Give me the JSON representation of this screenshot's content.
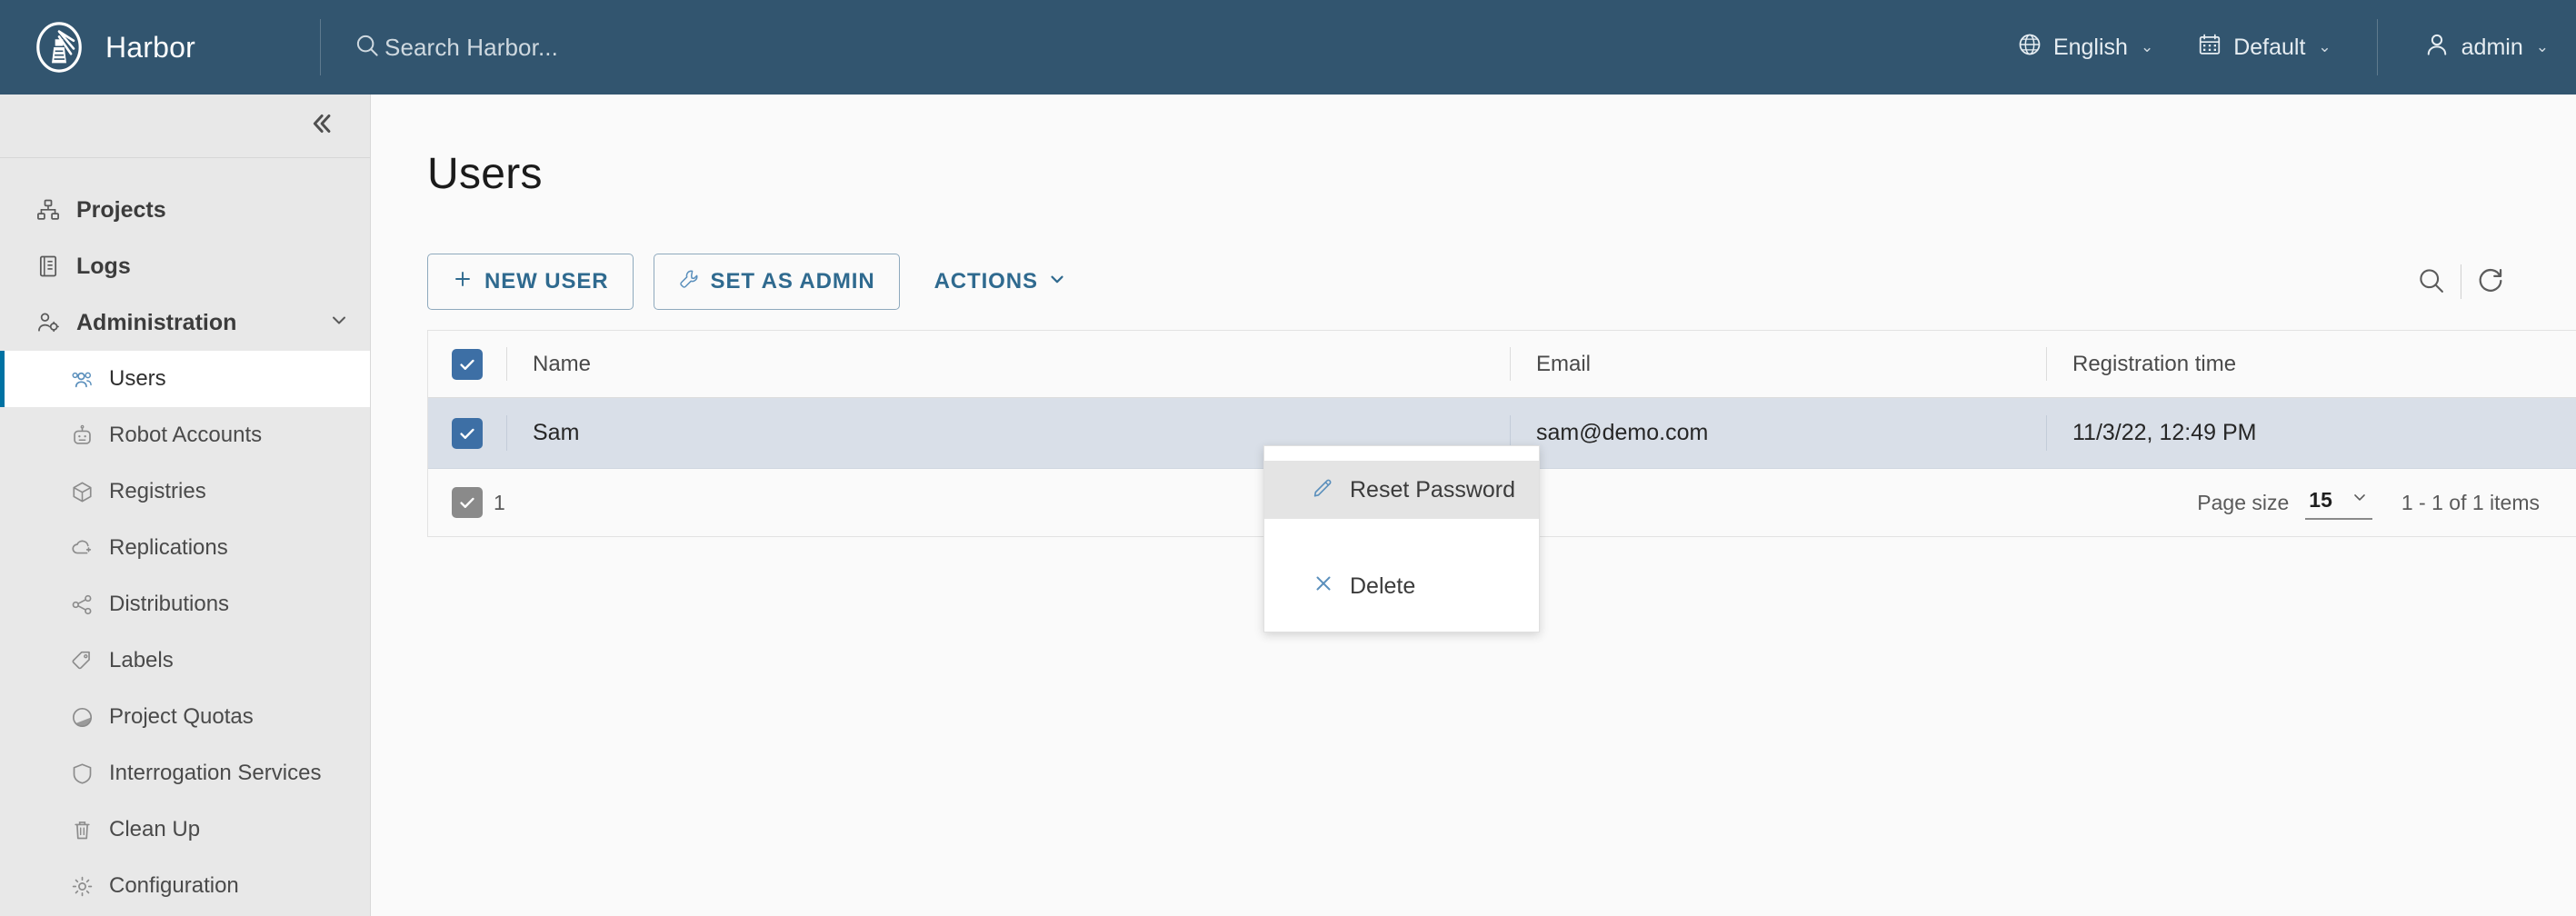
{
  "header": {
    "brand": "Harbor",
    "brand_logo_icon": "harbor-lighthouse-logo",
    "search_icon": "search-icon",
    "search_placeholder": "Search Harbor...",
    "language": "English",
    "language_icon": "globe-icon",
    "project": "Default",
    "project_icon": "calendar-icon",
    "user": "admin",
    "user_icon": "user-icon",
    "caret": "⌄",
    "bg_color": "#32556f"
  },
  "sidebar": {
    "collapse_icon": "double-chevron-left-icon",
    "items": [
      {
        "label": "Projects",
        "icon": "projects-icon",
        "level": "top"
      },
      {
        "label": "Logs",
        "icon": "logs-icon",
        "level": "top"
      },
      {
        "label": "Administration",
        "icon": "administration-icon",
        "level": "top",
        "expanded": true,
        "chevron": "chevron-down-icon"
      }
    ],
    "sub_items": [
      {
        "label": "Users",
        "icon": "users-icon",
        "active": true
      },
      {
        "label": "Robot Accounts",
        "icon": "robot-icon",
        "active": false
      },
      {
        "label": "Registries",
        "icon": "registries-icon",
        "active": false
      },
      {
        "label": "Replications",
        "icon": "replications-icon",
        "active": false
      },
      {
        "label": "Distributions",
        "icon": "distributions-icon",
        "active": false
      },
      {
        "label": "Labels",
        "icon": "label-tag-icon",
        "active": false
      },
      {
        "label": "Project Quotas",
        "icon": "quotas-pie-icon",
        "active": false
      },
      {
        "label": "Interrogation Services",
        "icon": "shield-icon",
        "active": false
      },
      {
        "label": "Clean Up",
        "icon": "trash-icon",
        "active": false
      },
      {
        "label": "Configuration",
        "icon": "gear-icon",
        "active": false
      }
    ],
    "active_accent": "#0072a3"
  },
  "main": {
    "page_title": "Users",
    "toolbar": {
      "new_user_label": "NEW USER",
      "new_user_icon": "plus-icon",
      "set_as_admin_label": "SET AS ADMIN",
      "set_as_admin_icon": "wrench-icon",
      "actions_label": "ACTIONS",
      "actions_caret": "chevron-down-icon",
      "search_icon": "search-icon",
      "refresh_icon": "refresh-icon"
    },
    "dropdown": {
      "open": true,
      "items": [
        {
          "label": "Reset Password",
          "icon": "pencil-icon",
          "highlighted": true
        },
        {
          "label": "Delete",
          "icon": "close-x-icon",
          "highlighted": false
        }
      ]
    },
    "table": {
      "columns": [
        "Name",
        "Email",
        "Registration time"
      ],
      "header_checkbox_checked": true,
      "rows": [
        {
          "checked": true,
          "name": "Sam",
          "email": "sam@demo.com",
          "registration_time": "11/3/22, 12:49 PM",
          "selected": true
        }
      ],
      "footer": {
        "selected_count": "1",
        "selected_checkbox_checked": true,
        "page_size_label": "Page size",
        "page_size_value": "15",
        "page_size_caret": "chevron-down-icon",
        "items_range": "1 - 1 of 1 items"
      }
    }
  }
}
